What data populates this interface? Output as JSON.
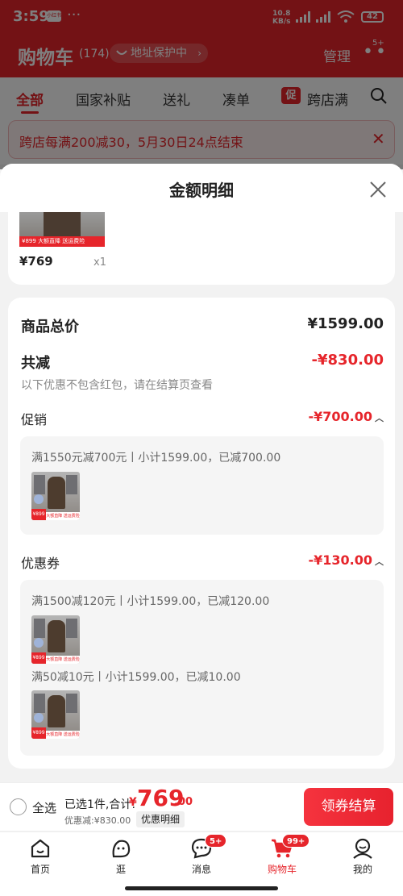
{
  "status_bar": {
    "time": "3:59",
    "app_badge": "小红书",
    "dots": "···",
    "net_speed_value": "10.8",
    "net_speed_unit": "KB/s",
    "battery": "42"
  },
  "header": {
    "title": "购物车",
    "count": "(174)",
    "address_pill": "地址保护中",
    "manage": "管理",
    "more_badge": "5+"
  },
  "tabs": [
    {
      "label": "全部",
      "active": true
    },
    {
      "label": "国家补贴"
    },
    {
      "label": "送礼"
    },
    {
      "label": "凑单"
    },
    {
      "label": "跨店满",
      "icon_text": "促"
    }
  ],
  "banner": {
    "text": "跨店每满200减30，5月30日24点结束"
  },
  "sheet": {
    "title": "金额明细",
    "item": {
      "thumb_tag": "大额直降 送运费险",
      "thumb_price": "¥899",
      "price": "¥769",
      "qty": "x1"
    },
    "total_label": "商品总价",
    "total_value": "¥1599.00",
    "reduce_label": "共减",
    "reduce_value": "-¥830.00",
    "reduce_note": "以下优惠不包含红包，请在结算页查看",
    "promo": {
      "label": "促销",
      "value": "-¥700.00",
      "details": [
        {
          "text": "满1550元减700元丨小计1599.00，已减700.00"
        }
      ]
    },
    "coupon": {
      "label": "优惠券",
      "value": "-¥130.00",
      "details": [
        {
          "text": "满1500减120元丨小计1599.00，已减120.00"
        },
        {
          "text": "满50减10元丨小计1599.00，已减10.00"
        }
      ]
    },
    "thumb_small_price": "¥899",
    "thumb_small_tag": "大额直降 送运费险"
  },
  "checkout": {
    "select_all": "全选",
    "selected_text": "已选1件,合计:",
    "currency": "¥",
    "amount_int": "769",
    "amount_dec": ".00",
    "discount_text": "优惠减:¥830.00",
    "detail_button": "优惠明细",
    "pay_button": "领券结算"
  },
  "nav": {
    "items": [
      {
        "label": "首页",
        "icon": "home-icon"
      },
      {
        "label": "逛",
        "icon": "browse-face-icon"
      },
      {
        "label": "消息",
        "icon": "message-icon",
        "badge": "5+"
      },
      {
        "label": "购物车",
        "icon": "cart-icon",
        "badge": "99+",
        "active": true
      },
      {
        "label": "我的",
        "icon": "profile-icon"
      }
    ]
  },
  "colors": {
    "brand_red": "#e6252b",
    "background": "#f2f2f2"
  }
}
